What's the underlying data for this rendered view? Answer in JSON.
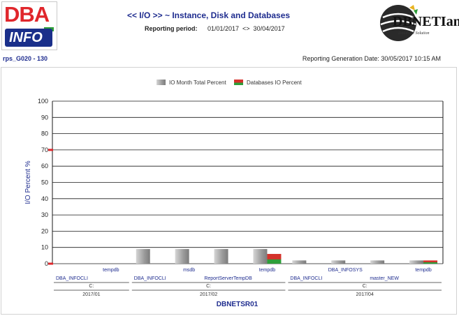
{
  "header": {
    "title": "<< I/O >> ~ Instance, Disk and Databases",
    "period_label": "Reporting period:",
    "period_value": "01/01/2017  <>  30/04/2017",
    "report_id": "rps_G020 - 130",
    "generation_date": "Reporting Generation Date: 30/05/2017 10:15 AM"
  },
  "logos": {
    "left_main": "DBA",
    "left_sub": "INFO",
    "right_main": "DBNETIan",
    "right_sub": "Database Solution"
  },
  "colors": {
    "title": "#1f2d8f",
    "bar_gray": "#a8a8a8",
    "bar_green": "#2e9e3a",
    "bar_red": "#d4322b",
    "marker_red": "#e0262b"
  },
  "chart_data": {
    "type": "bar",
    "legend": [
      "IO Month Total Percent",
      "Databases IO Percent"
    ],
    "ylabel": "I/O Percent %",
    "xlabel": "DBNETSR01",
    "ylim": [
      0,
      100
    ],
    "yticks": [
      0,
      10,
      20,
      30,
      40,
      50,
      60,
      70,
      80,
      90,
      100
    ],
    "threshold_marker": 70,
    "categories": [
      {
        "db": "DBA_INFOCLI",
        "disk": "C:",
        "month": "2017/01",
        "total": 0,
        "db_io": 0
      },
      {
        "db": "tempdb",
        "disk": "C:",
        "month": "2017/01",
        "total": 0,
        "db_io": 0
      },
      {
        "db": "DBA_INFOCLI",
        "disk": "C:",
        "month": "2017/02",
        "total": 9,
        "db_io": 0
      },
      {
        "db": "msdb",
        "disk": "C:",
        "month": "2017/02",
        "total": 9,
        "db_io": 0
      },
      {
        "db": "ReportServerTempDB",
        "disk": "C:",
        "month": "2017/02",
        "total": 9,
        "db_io": 0
      },
      {
        "db": "tempdb",
        "disk": "C:",
        "month": "2017/02",
        "total": 9,
        "db_io": 6
      },
      {
        "db": "DBA_INFOCLI",
        "disk": "C:",
        "month": "2017/04",
        "total": 2,
        "db_io": 0
      },
      {
        "db": "DBA_INFOSYS",
        "disk": "C:",
        "month": "2017/04",
        "total": 2,
        "db_io": 0
      },
      {
        "db": "master_NEW",
        "disk": "C:",
        "month": "2017/04",
        "total": 2,
        "db_io": 0
      },
      {
        "db": "tempdb",
        "disk": "C:",
        "month": "2017/04",
        "total": 2,
        "db_io": 2
      }
    ],
    "groups": [
      {
        "disk": "C:",
        "month": "2017/01",
        "from": 0,
        "to": 1
      },
      {
        "disk": "C:",
        "month": "2017/02",
        "from": 2,
        "to": 5
      },
      {
        "disk": "C:",
        "month": "2017/04",
        "from": 6,
        "to": 9
      }
    ]
  }
}
